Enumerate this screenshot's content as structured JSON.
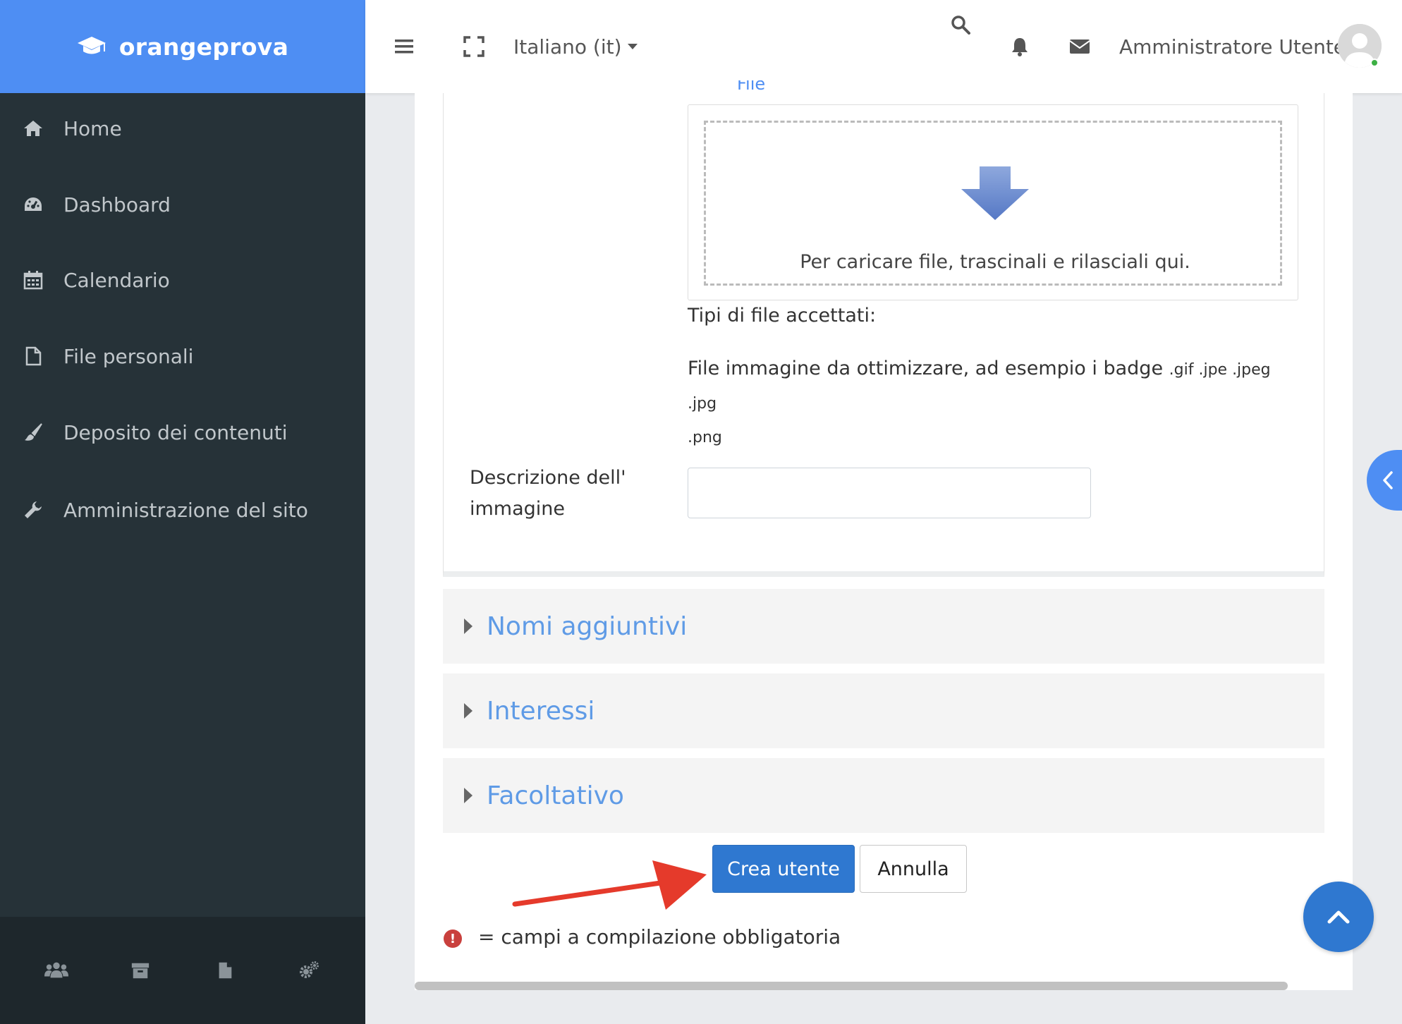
{
  "brand": {
    "name": "orangeprova"
  },
  "sidebar": {
    "items": [
      {
        "label": "Home",
        "icon": "home-icon"
      },
      {
        "label": "Dashboard",
        "icon": "dashboard-icon"
      },
      {
        "label": "Calendario",
        "icon": "calendar-icon"
      },
      {
        "label": "File personali",
        "icon": "file-icon"
      },
      {
        "label": "Deposito dei contenuti",
        "icon": "brush-icon"
      },
      {
        "label": "Amministrazione del sito",
        "icon": "wrench-icon"
      }
    ],
    "footer_icons": [
      "users-icon",
      "archive-icon",
      "file-icon",
      "cogs-icon"
    ]
  },
  "topbar": {
    "language": "Italiano (it)",
    "user_name": "Amministratore Utente"
  },
  "form": {
    "file_label": "File",
    "drop_text": "Per caricare file, trascinali e rilasciali qui.",
    "accepted_label": "Tipi di file accettati:",
    "accepted_desc": "File immagine da ottimizzare, ad esempio i badge",
    "accepted_ext_1": ".gif .jpe .jpeg .jpg",
    "accepted_ext_2": ".png",
    "image_desc_label": "Descrizione dell' immagine",
    "image_desc_value": "",
    "sections": [
      "Nomi aggiuntivi",
      "Interessi",
      "Facoltativo"
    ],
    "submit_label": "Crea utente",
    "cancel_label": "Annulla",
    "required_note": "= campi a compilazione obbligatoria",
    "required_symbol": "!"
  },
  "colors": {
    "brand_blue": "#4e8ef3",
    "primary_button": "#2f78d0",
    "sidebar_bg": "#263238",
    "section_link": "#5f9be6",
    "annotation_arrow": "#e53a2b",
    "required": "#c9403d"
  }
}
